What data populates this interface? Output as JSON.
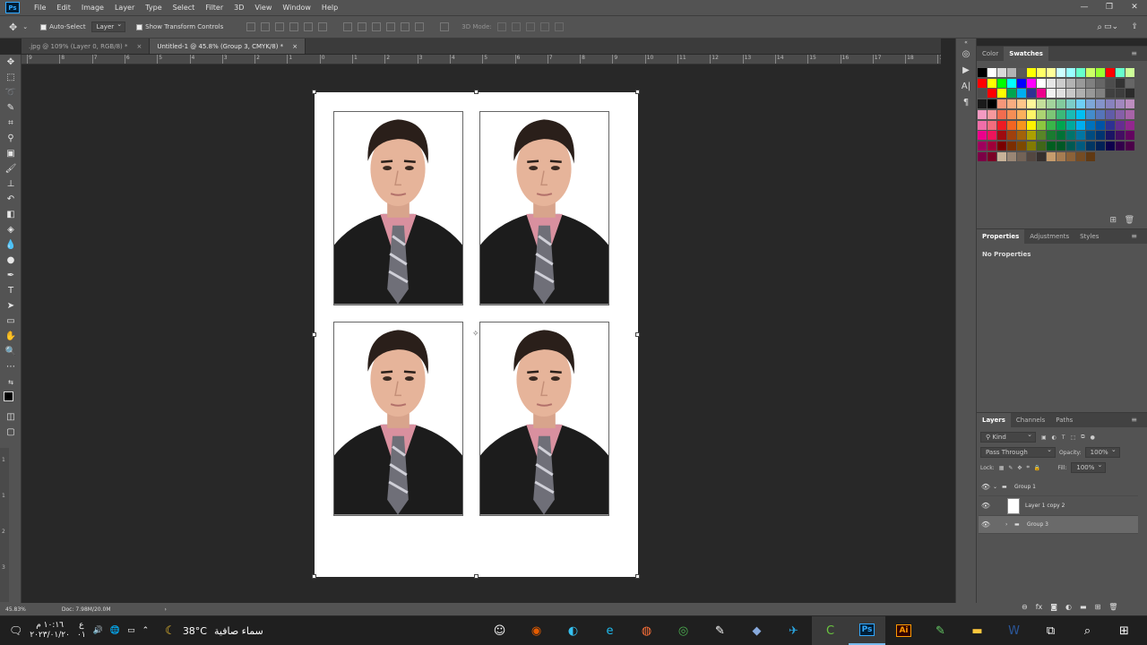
{
  "menubar": {
    "app_icon": "Ps",
    "items": [
      "File",
      "Edit",
      "Image",
      "Layer",
      "Type",
      "Select",
      "Filter",
      "3D",
      "View",
      "Window",
      "Help"
    ],
    "window_buttons": [
      "—",
      "❐",
      "✕"
    ]
  },
  "options": {
    "auto_select_label": "Auto-Select",
    "auto_select_value": "Layer",
    "transform_controls_label": "Show Transform Controls",
    "mode_3d_label": "3D Mode:"
  },
  "tabs": [
    {
      "label": ".jpg @ 109% (Layer 0, RGB/8) *",
      "active": false
    },
    {
      "label": "Untitled-1 @ 45.8% (Group 3, CMYK/8) *",
      "active": true
    }
  ],
  "ruler_ticks": [
    "9",
    "8",
    "7",
    "6",
    "5",
    "4",
    "3",
    "2",
    "1",
    "0",
    "1",
    "2",
    "3",
    "4",
    "5",
    "6",
    "7",
    "8",
    "9",
    "10",
    "11",
    "12",
    "13",
    "14",
    "15",
    "16",
    "17",
    "18",
    "19"
  ],
  "vruler_ticks": [
    "1",
    "1",
    "2",
    "3"
  ],
  "status": {
    "zoom": "45.83%",
    "doc": "Doc: 7.98M/20.0M",
    "arrow": "›"
  },
  "color_panel": {
    "tabs": [
      "Color",
      "Swatches"
    ],
    "active": "Swatches"
  },
  "swatch_colors": [
    "#000000",
    "#ffffff",
    "#d9d9d9",
    "#b3b3b3",
    "#595959",
    "#ffff00",
    "#ffff66",
    "#ffff99",
    "#ccffff",
    "#99ffff",
    "#66ffcc",
    "#ccff66",
    "#99ff33",
    "#ff0000",
    "#66ffcc",
    "#ccff99",
    "#ff0000",
    "#ffff00",
    "#00ff00",
    "#00ffff",
    "#0000ff",
    "#ff00ff",
    "#ffffff",
    "#e6e6e6",
    "#cccccc",
    "#b3b3b3",
    "#999999",
    "#808080",
    "#666666",
    "#4d4d4d",
    "#333333",
    "#666666",
    "#4d4d4d",
    "#ff0000",
    "#ffff00",
    "#00a651",
    "#00aeef",
    "#2e3192",
    "#ec008c",
    "#f2f2f2",
    "#e0e0e0",
    "#c8c8c8",
    "#b0b0b0",
    "#989898",
    "#808080",
    "#404040",
    "#3d3d3d",
    "#2b2b2b",
    "#1a1a1a",
    "#000000",
    "#f7977a",
    "#f9ad81",
    "#fdc68a",
    "#fff79a",
    "#c4df9b",
    "#a3d39c",
    "#82ca9d",
    "#7bcdc8",
    "#6ecff6",
    "#7ea7d8",
    "#8493ca",
    "#8882be",
    "#a187be",
    "#bc8dbf",
    "#f49ac2",
    "#f6989d",
    "#f26c4f",
    "#f68e55",
    "#fbaf5c",
    "#fff467",
    "#acd372",
    "#7cc576",
    "#3bb878",
    "#1abbb4",
    "#00bff3",
    "#438ccb",
    "#5574b9",
    "#605ca8",
    "#855fa8",
    "#a763a8",
    "#f06ea9",
    "#f26d7d",
    "#ed1c24",
    "#f26522",
    "#f7941d",
    "#fff200",
    "#8dc73f",
    "#39b54a",
    "#00a651",
    "#00a99d",
    "#00aeef",
    "#0072bc",
    "#0054a6",
    "#2e3192",
    "#662d91",
    "#92278f",
    "#ec008c",
    "#ed145b",
    "#9e0b0f",
    "#a0410d",
    "#a36209",
    "#aba000",
    "#598527",
    "#197b30",
    "#007236",
    "#00746b",
    "#0076a3",
    "#004b80",
    "#003471",
    "#1b1464",
    "#440e62",
    "#630460",
    "#9e005d",
    "#9e0039",
    "#790000",
    "#7b2e00",
    "#7d4900",
    "#827b00",
    "#406618",
    "#005e20",
    "#005826",
    "#005952",
    "#005b7f",
    "#003663",
    "#002157",
    "#0d004c",
    "#32004b",
    "#4b0049",
    "#7b0046",
    "#7a0026",
    "#c7b299",
    "#998675",
    "#736357",
    "#534741",
    "#362f2d",
    "#c69c6d",
    "#a67c52",
    "#8c6239",
    "#754c24",
    "#603913"
  ],
  "properties": {
    "tabs": [
      "Properties",
      "Adjustments",
      "Styles"
    ],
    "active": "Properties",
    "content": "No Properties"
  },
  "layers_panel": {
    "tabs": [
      "Layers",
      "Channels",
      "Paths"
    ],
    "active": "Layers",
    "filter": "Kind",
    "blend_mode": "Pass Through",
    "opacity_label": "Opacity:",
    "opacity": "100%",
    "lock_label": "Lock:",
    "fill_label": "Fill:",
    "fill": "100%",
    "layers": [
      {
        "name": "Group 1",
        "type": "group",
        "expanded": true,
        "selected": false
      },
      {
        "name": "Layer 1 copy 2",
        "type": "layer",
        "selected": false
      },
      {
        "name": "Group 3",
        "type": "group",
        "expanded": false,
        "selected": true
      }
    ]
  },
  "taskbar": {
    "time": "١٠:١٦ م",
    "date": "٢٠٢٣/٠١/٢٠",
    "lang": "ع",
    "lang2": "٠١",
    "weather_temp": "38°C",
    "weather_text": "سماء صافية",
    "apps": [
      "teams",
      "maps",
      "edge",
      "ie",
      "firefox",
      "chrome",
      "inkscape",
      "3d",
      "telegram",
      "camtasia",
      "photoshop",
      "illustrator",
      "tool",
      "explorer",
      "word",
      "taskview",
      "search",
      "start"
    ],
    "active_app": "photoshop"
  }
}
